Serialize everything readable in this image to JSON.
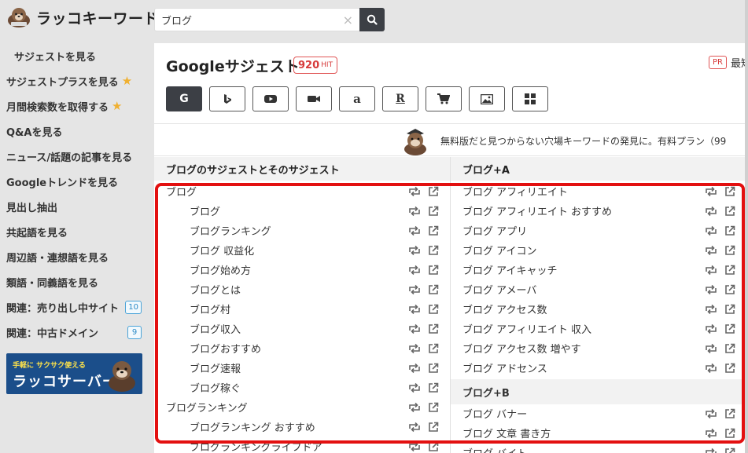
{
  "header": {
    "logo_text": "ラッコキーワード",
    "search_value": "ブログ",
    "clear_symbol": "×"
  },
  "sidebar": {
    "items": [
      {
        "label": "サジェストを見る",
        "active": true
      },
      {
        "label": "サジェストプラスを見る",
        "star": true
      },
      {
        "label": "月間検索数を取得する",
        "star": true
      },
      {
        "label": "Q&Aを見る"
      },
      {
        "label": "ニュース/話題の記事を見る"
      },
      {
        "label": "Googleトレンドを見る"
      },
      {
        "label": "見出し抽出"
      },
      {
        "label": "共起語を見る"
      },
      {
        "label": "周辺語・連想語を見る"
      },
      {
        "label": "類語・同義語を見る"
      },
      {
        "label": "関連：売り出し中サイト",
        "badge": "10"
      },
      {
        "label": "関連：中古ドメイン",
        "badge": "9"
      }
    ],
    "star_glyph": "★",
    "banner": {
      "small": "手軽に サクサク使える",
      "big": "ラッコサーバー"
    }
  },
  "main": {
    "title": "Googleサジェスト",
    "hit_count": "920",
    "hit_unit": "HIT",
    "pr_badge": "PR",
    "pr_text": "最短",
    "engines": [
      "google",
      "bing",
      "youtube",
      "video",
      "amazon",
      "rakuten",
      "shopping",
      "image",
      "apps"
    ],
    "engine_glyphs": {
      "google": "G",
      "bing": "b",
      "amazon": "a",
      "rakuten": "R"
    },
    "promo_text": "無料版だと見つからない穴場キーワードの発見に。有料プラン（99"
  },
  "left_column": {
    "header": "ブログのサジェストとそのサジェスト",
    "rows": [
      {
        "text": "ブログ",
        "indent": 0
      },
      {
        "text": "ブログ",
        "indent": 1
      },
      {
        "text": "ブログランキング",
        "indent": 1
      },
      {
        "text": "ブログ 収益化",
        "indent": 1
      },
      {
        "text": "ブログ始め方",
        "indent": 1
      },
      {
        "text": "ブログとは",
        "indent": 1
      },
      {
        "text": "ブログ村",
        "indent": 1
      },
      {
        "text": "ブログ収入",
        "indent": 1
      },
      {
        "text": "ブログおすすめ",
        "indent": 1
      },
      {
        "text": "ブログ速報",
        "indent": 1
      },
      {
        "text": "ブログ稼ぐ",
        "indent": 1
      },
      {
        "text": "ブログランキング",
        "indent": 0
      },
      {
        "text": "ブログランキング おすすめ",
        "indent": 1
      },
      {
        "text": "ブログランキングライフドア",
        "indent": 1
      }
    ]
  },
  "right_column": {
    "header": "ブログ+A",
    "rows": [
      "ブログ アフィリエイト",
      "ブログ アフィリエイト おすすめ",
      "ブログ アプリ",
      "ブログ アイコン",
      "ブログ アイキャッチ",
      "ブログ アメーバ",
      "ブログ アクセス数",
      "ブログ アフィリエイト 収入",
      "ブログ アクセス数 増やす",
      "ブログ アドセンス"
    ],
    "subheader": "ブログ+B",
    "rows_b": [
      "ブログ バナー",
      "ブログ 文章 書き方",
      "ブログ バイト"
    ]
  },
  "colors": {
    "accent": "#3c3f45",
    "highlight": "#e31010",
    "badge_red": "#d73a3a",
    "badge_blue": "#2c8ac6"
  }
}
